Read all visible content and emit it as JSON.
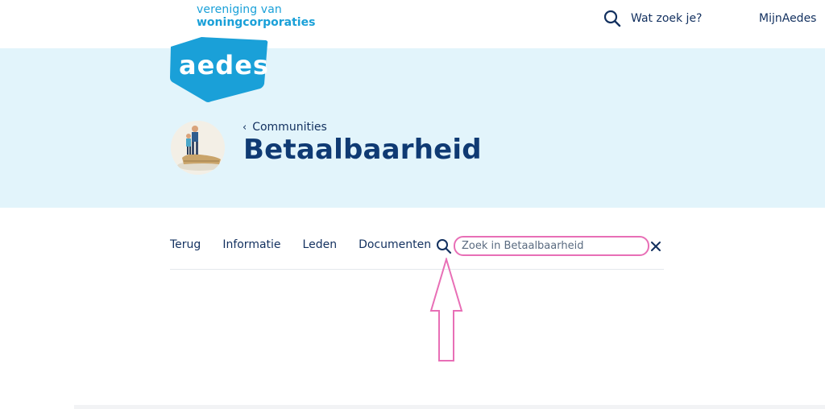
{
  "header": {
    "org_line1": "vereniging van",
    "org_line2": "woningcorporaties",
    "search_label": "Wat zoek je?",
    "account_link": "MijnAedes"
  },
  "hero": {
    "logo_text": "aedes",
    "back_link": "Communities",
    "title": "Betaalbaarheid"
  },
  "tabs": [
    "Terug",
    "Informatie",
    "Leden",
    "Documenten"
  ],
  "search": {
    "placeholder": "Zoek in Betaalbaarheid",
    "value": ""
  },
  "colors": {
    "brand_blue": "#1aa0d8",
    "navy": "#12305f",
    "hero_bg": "#e2f4fb",
    "highlight_pink": "#e86fb6"
  }
}
